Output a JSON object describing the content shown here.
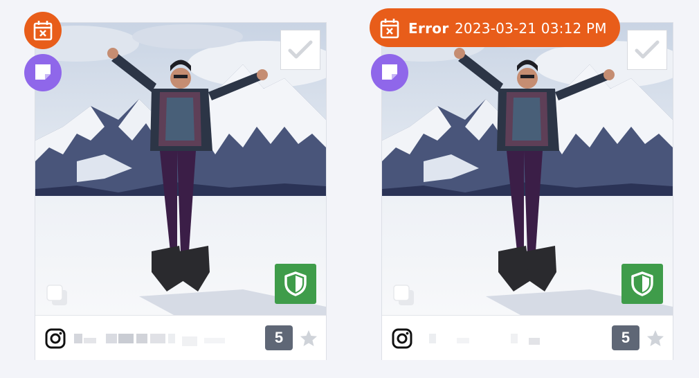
{
  "colors": {
    "schedule_orange": "#e85d1a",
    "note_purple": "#8f67ea",
    "shield_green": "#3f9c4a",
    "count_gray": "#5f6776",
    "page_bg": "#f3f4f9"
  },
  "cards": [
    {
      "schedule_icon": "calendar-x-icon",
      "note_icon": "sticky-note-icon",
      "select_icon": "checkmark-icon",
      "rights_icon": "shield-icon",
      "media_icon": "multiple-media-icon",
      "platform_icon": "instagram-icon",
      "comment_count": "5",
      "favorite_icon": "star-icon"
    },
    {
      "status": {
        "label": "Error",
        "timestamp": "2023-03-21 03:12 PM",
        "icon": "calendar-x-icon"
      },
      "note_icon": "sticky-note-icon",
      "select_icon": "checkmark-icon",
      "rights_icon": "shield-icon",
      "media_icon": "multiple-media-icon",
      "platform_icon": "instagram-icon",
      "comment_count": "5",
      "favorite_icon": "star-icon"
    }
  ]
}
